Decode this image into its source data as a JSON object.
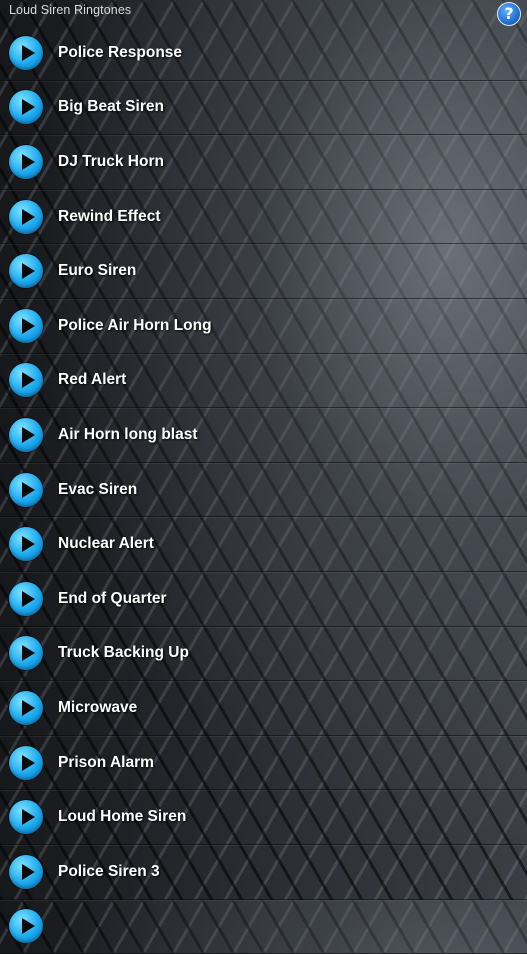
{
  "header": {
    "title": "Loud Siren Ringtones",
    "help_glyph": "?"
  },
  "accent_color": "#1ba8ee",
  "icons": {
    "row": "play-icon",
    "help": "help-icon"
  },
  "items": [
    {
      "label": "Police Response"
    },
    {
      "label": "Big Beat Siren"
    },
    {
      "label": "DJ Truck Horn"
    },
    {
      "label": "Rewind Effect"
    },
    {
      "label": "Euro Siren"
    },
    {
      "label": "Police Air Horn Long"
    },
    {
      "label": "Red Alert"
    },
    {
      "label": "Air Horn long blast"
    },
    {
      "label": "Evac Siren"
    },
    {
      "label": "Nuclear Alert"
    },
    {
      "label": "End of Quarter"
    },
    {
      "label": "Truck Backing Up"
    },
    {
      "label": "Microwave"
    },
    {
      "label": "Prison Alarm"
    },
    {
      "label": "Loud Home Siren"
    },
    {
      "label": "Police Siren 3"
    },
    {
      "label": ""
    }
  ]
}
